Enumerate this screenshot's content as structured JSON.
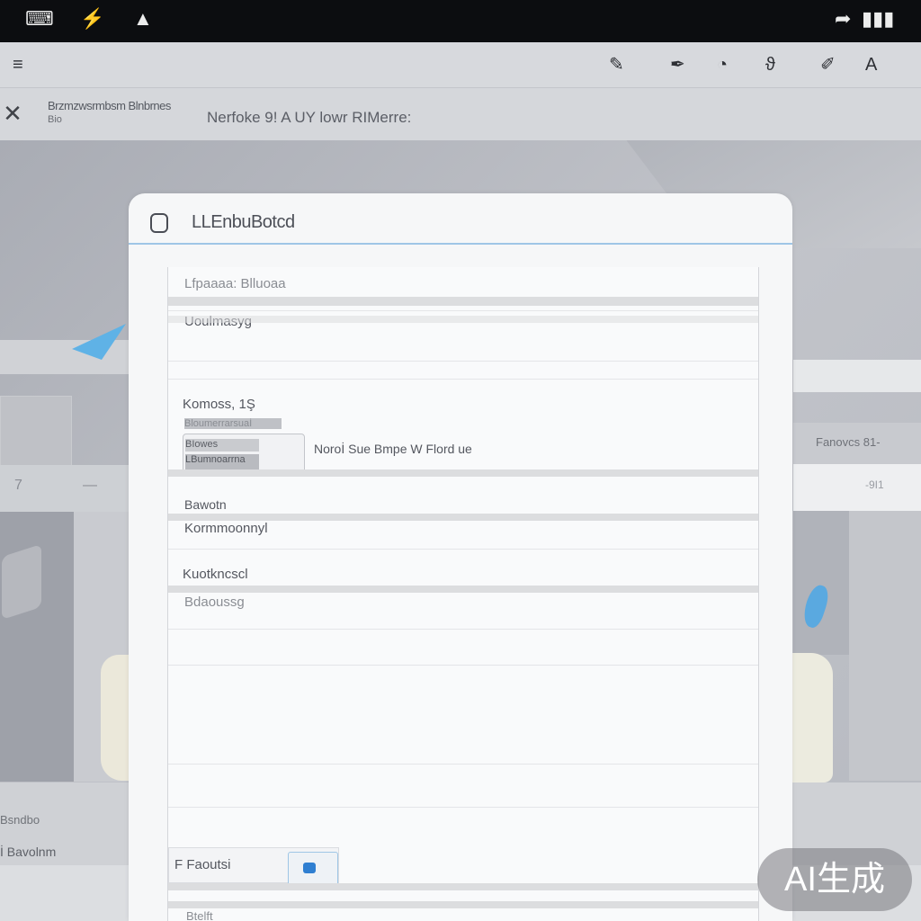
{
  "status_bar": {
    "left_icons": [
      "keyboard-icon",
      "chart-icon",
      "mountain-icon"
    ],
    "right_icons": [
      "signal-icon",
      "battery-icon"
    ]
  },
  "toolbar": {
    "menu_icon": "menu-icon",
    "tools": [
      "pencil-icon",
      "pen-icon",
      "eraser-icon",
      "brush-icon",
      "highlighter-icon",
      "text-icon"
    ]
  },
  "header": {
    "title": "Brzmzwsrmbsm Blnbrnes",
    "subtitle": "Bio",
    "center_text": "Nerfoke 9! A UY lowr RIMerre:"
  },
  "dialog": {
    "title": "LLEnbuBotcd",
    "fields": [
      {
        "label": "Lfpaaaa: Blluoaa",
        "value": ""
      },
      {
        "label": "Uoulmasyg",
        "value": ""
      },
      {
        "label": "Komoss, 1Ş",
        "value": ""
      },
      {
        "label": "Bawotn",
        "value": "Kormmoonnyl"
      },
      {
        "label": "Kuotkncscl",
        "value": "Bdaoussg"
      }
    ],
    "input_values": [
      "Bloumerrarsuaİ",
      "BIowes",
      "LBumnoarrna"
    ],
    "hint_text": "Noroİ Sue Bmpe W Flord ue",
    "upload_label": "F Faoutsi",
    "footer_text": "Btelft"
  },
  "background": {
    "left_band_glyphs": [
      "7",
      "—"
    ],
    "right_band_text": "Fanovcs 81-",
    "right_band2_text": "-9I1",
    "bottom_line1": "Bsndbo",
    "bottom_line2": "İ Bavolnm"
  },
  "watermark": "AI生成"
}
